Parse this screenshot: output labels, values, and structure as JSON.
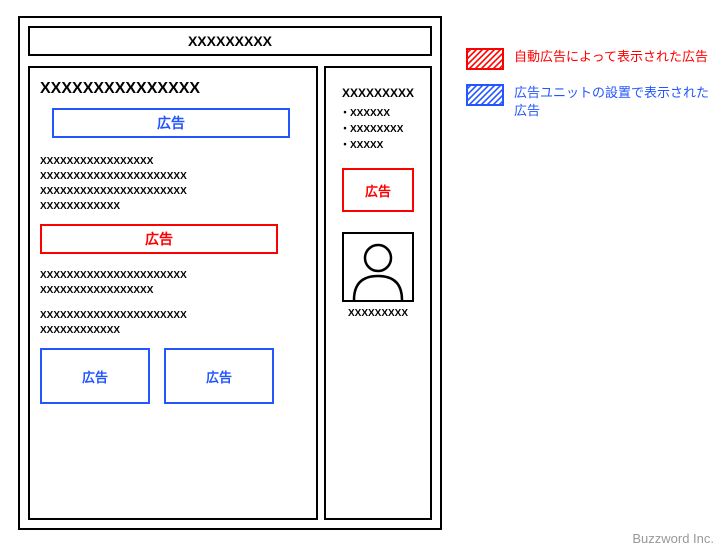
{
  "header": {
    "title": "XXXXXXXXX"
  },
  "main": {
    "heading": "XXXXXXXXXXXXXXX",
    "ad_label": "広告",
    "paragraph1": [
      "XXXXXXXXXXXXXXXXX",
      "XXXXXXXXXXXXXXXXXXXXXX",
      "XXXXXXXXXXXXXXXXXXXXXX",
      "XXXXXXXXXXXX"
    ],
    "paragraph2": [
      "XXXXXXXXXXXXXXXXXXXXXX",
      "XXXXXXXXXXXXXXXXX"
    ],
    "paragraph3": [
      "XXXXXXXXXXXXXXXXXXXXXX",
      "XXXXXXXXXXXX"
    ]
  },
  "sidebar": {
    "title": "XXXXXXXXX",
    "items": [
      "・XXXXXX",
      "・XXXXXXXX",
      "・XXXXX"
    ],
    "ad_label": "広告",
    "profile_label": "XXXXXXXXX"
  },
  "legend": {
    "auto_ad": "自動広告によって表示された広告",
    "unit_ad": "広告ユニットの設置で表示された広告"
  },
  "colors": {
    "blue": "#2456ff",
    "red": "#ff0000"
  },
  "footer": "Buzzword Inc."
}
